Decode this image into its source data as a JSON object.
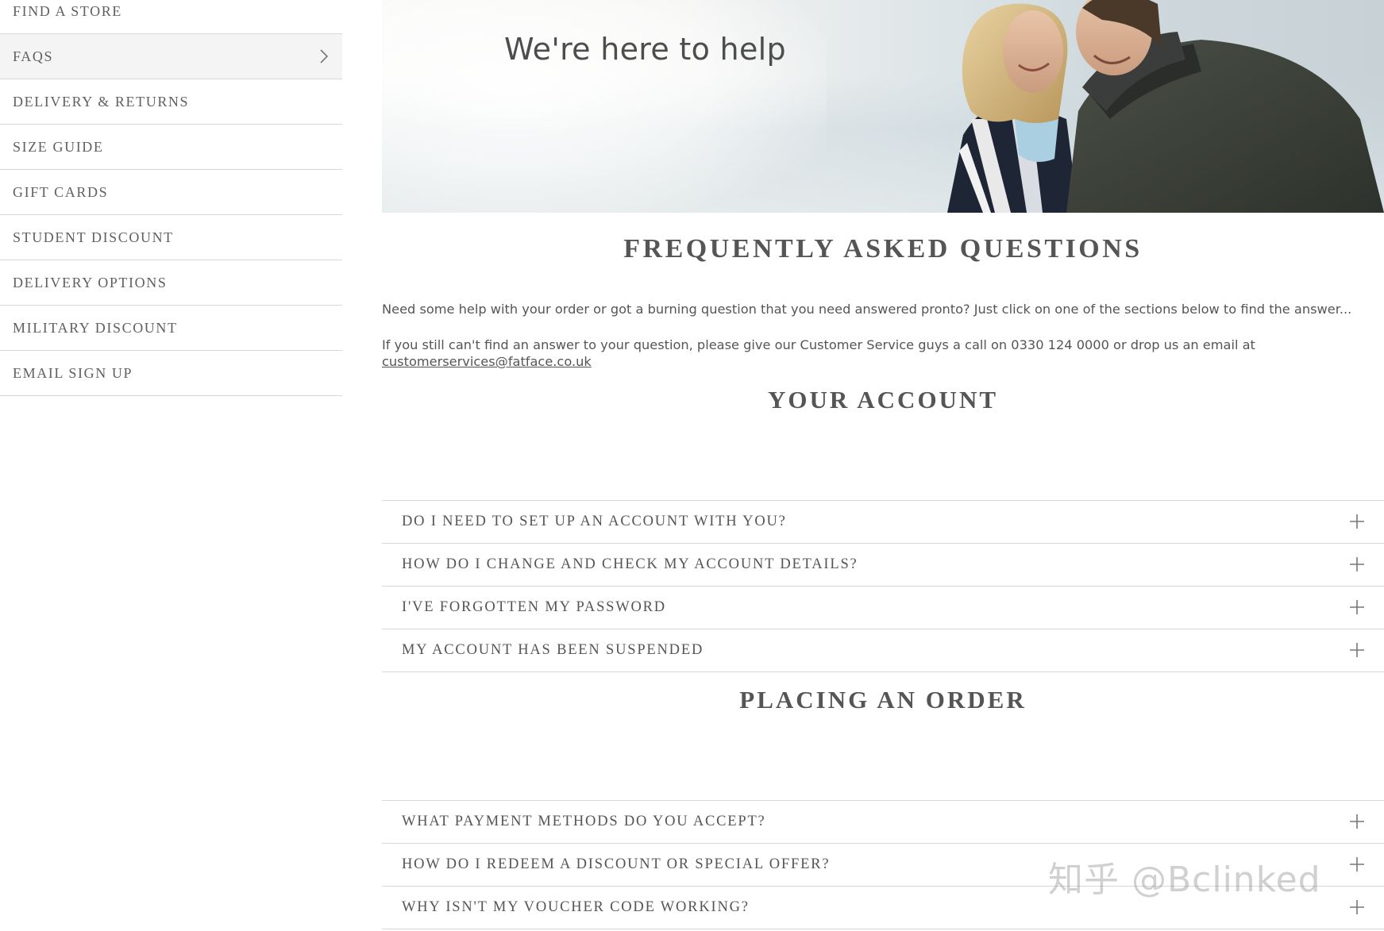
{
  "sidebar": {
    "items": [
      {
        "label": "FIND A STORE"
      },
      {
        "label": "FAQS"
      },
      {
        "label": "DELIVERY & RETURNS"
      },
      {
        "label": "SIZE GUIDE"
      },
      {
        "label": "GIFT CARDS"
      },
      {
        "label": "STUDENT DISCOUNT"
      },
      {
        "label": "DELIVERY OPTIONS"
      },
      {
        "label": "MILITARY DISCOUNT"
      },
      {
        "label": "EMAIL SIGN UP"
      }
    ],
    "active_index": 1
  },
  "hero": {
    "title": "We're here to help"
  },
  "faq": {
    "title": "FREQUENTLY ASKED QUESTIONS",
    "intro_1": "Need some help with your order or got a burning question that you need answered pronto? Just click on one of the sections below to find the answer...",
    "intro_2": "If you still can't find an answer to your question, please give our Customer Service guys a call on 0330 124 0000 or drop us an email at",
    "email": "customerservices@fatface.co.uk"
  },
  "sections": [
    {
      "title": "YOUR ACCOUNT",
      "questions": [
        "DO I NEED TO SET UP AN ACCOUNT WITH YOU?",
        "HOW DO I CHANGE AND CHECK MY ACCOUNT DETAILS?",
        "I'VE FORGOTTEN MY PASSWORD",
        "MY ACCOUNT HAS BEEN SUSPENDED"
      ]
    },
    {
      "title": "PLACING AN ORDER",
      "questions": [
        "WHAT PAYMENT METHODS DO YOU ACCEPT?",
        "HOW DO I REDEEM A DISCOUNT OR SPECIAL OFFER?",
        "WHY ISN'T MY VOUCHER CODE WORKING?"
      ]
    }
  ],
  "icons": {
    "expand": "plus-icon",
    "active_nav": "chevron-right-icon"
  },
  "watermark": "知乎 @Bclinked",
  "colors": {
    "text": "#555555",
    "divider": "#d8d8d8",
    "active_bg": "#f4f4f4"
  }
}
